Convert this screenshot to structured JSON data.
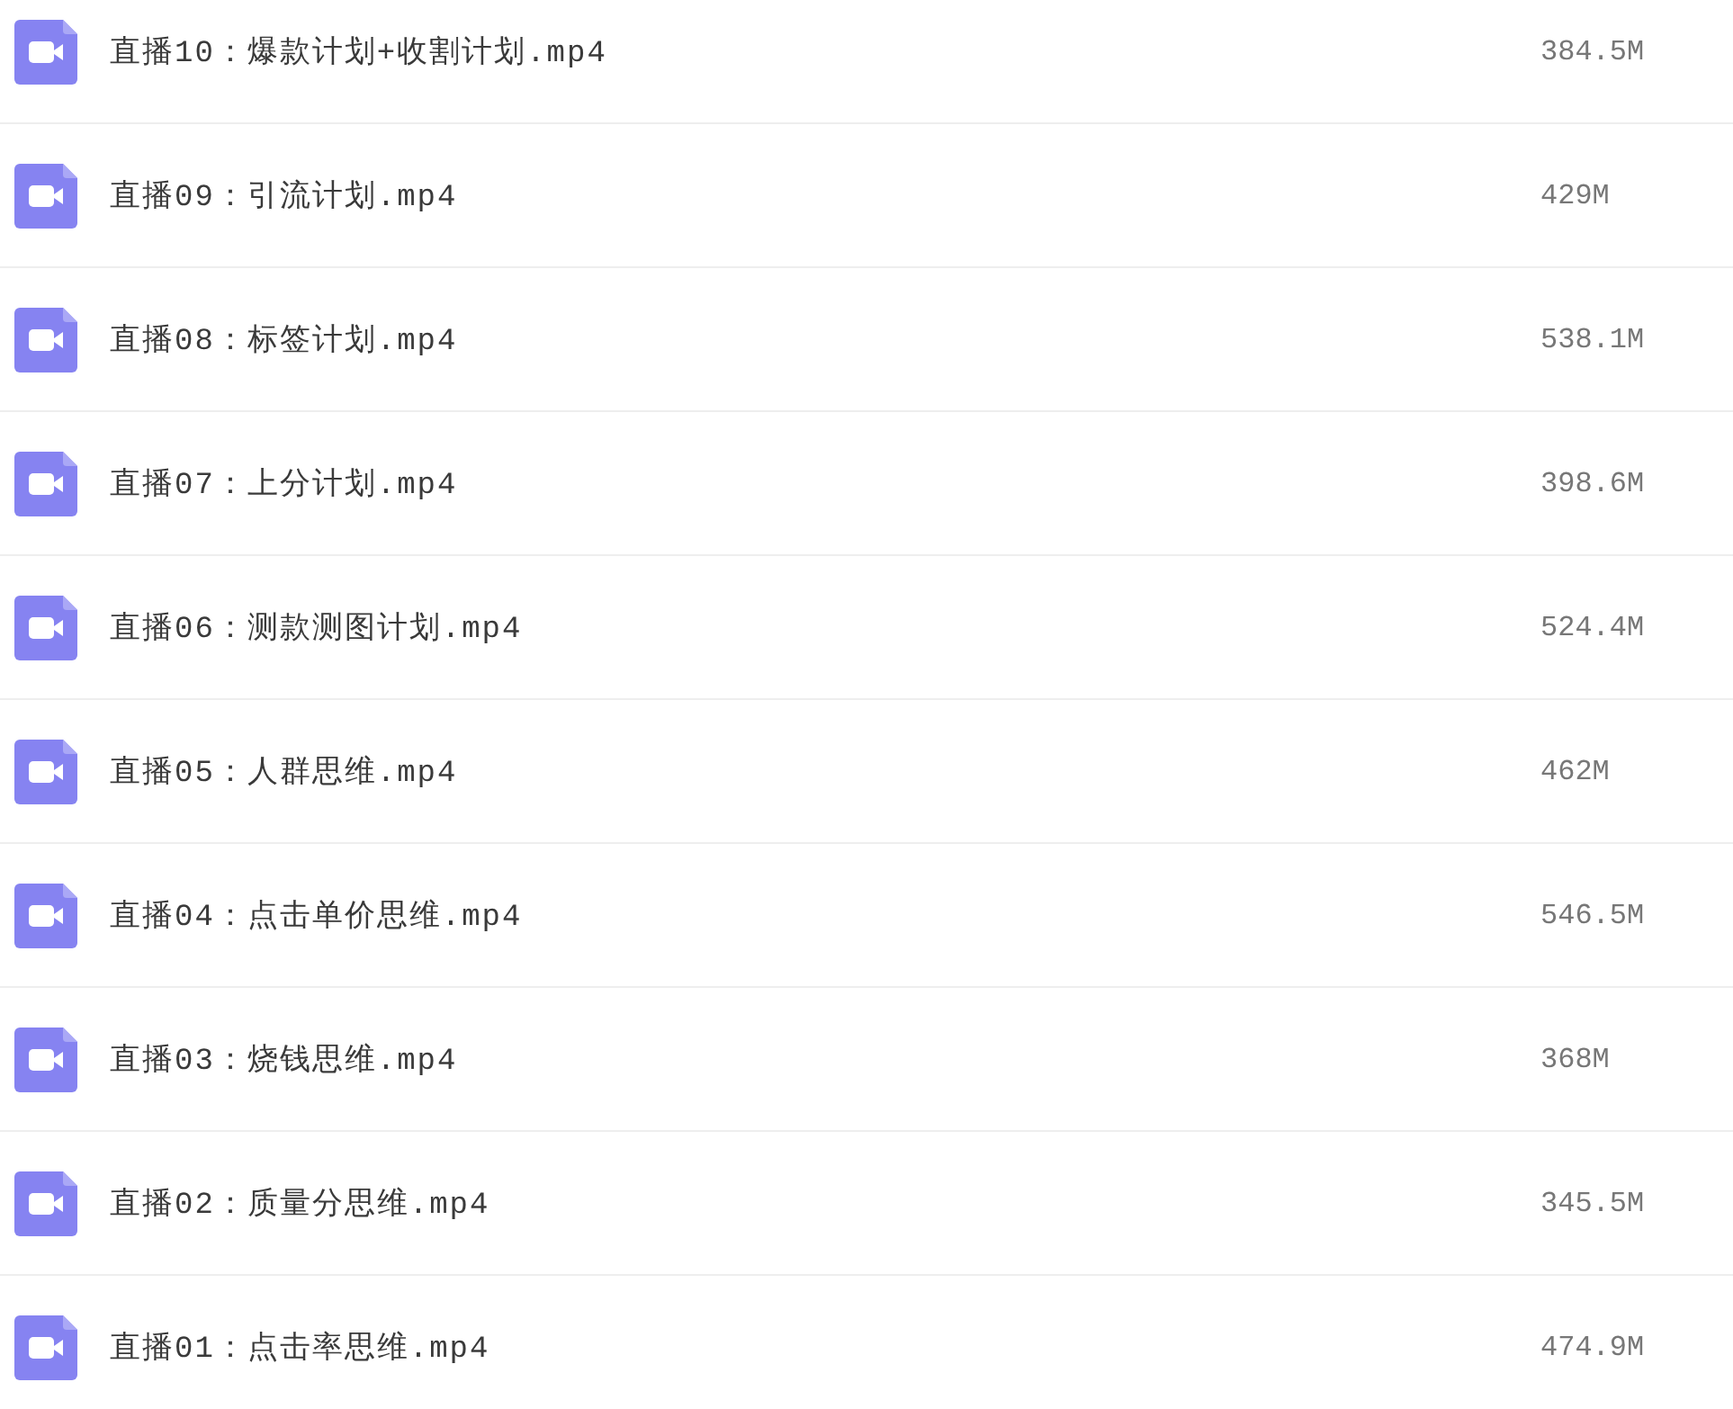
{
  "files": [
    {
      "name": "直播10：爆款计划+收割计划.mp4",
      "size": "384.5M"
    },
    {
      "name": "直播09：引流计划.mp4",
      "size": "429M"
    },
    {
      "name": "直播08：标签计划.mp4",
      "size": "538.1M"
    },
    {
      "name": "直播07：上分计划.mp4",
      "size": "398.6M"
    },
    {
      "name": "直播06：测款测图计划.mp4",
      "size": "524.4M"
    },
    {
      "name": "直播05：人群思维.mp4",
      "size": "462M"
    },
    {
      "name": "直播04：点击单价思维.mp4",
      "size": "546.5M"
    },
    {
      "name": "直播03：烧钱思维.mp4",
      "size": "368M"
    },
    {
      "name": "直播02：质量分思维.mp4",
      "size": "345.5M"
    },
    {
      "name": "直播01：点击率思维.mp4",
      "size": "474.9M"
    }
  ]
}
